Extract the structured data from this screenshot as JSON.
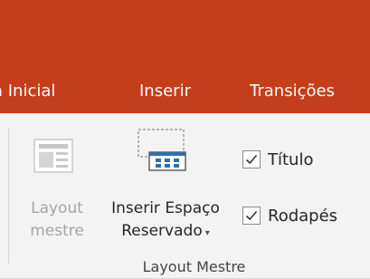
{
  "colors": {
    "accent": "#c43e1c",
    "ribbon_background": "#f3f3f3",
    "text": "#262626",
    "disabled_text": "#a6a6a6"
  },
  "tabs": [
    {
      "label": "a Inicial"
    },
    {
      "label": "Inserir"
    },
    {
      "label": "Transições"
    }
  ],
  "ribbon": {
    "layout_button": {
      "line1": "Layout",
      "line2": "mestre",
      "icon": "slide-layout-icon",
      "enabled": false
    },
    "insert_placeholder_button": {
      "line1": "Inserir Espaço",
      "line2": "Reservado",
      "icon": "insert-placeholder-icon",
      "has_dropdown": true
    },
    "checkboxes": [
      {
        "label": "Título",
        "checked": true
      },
      {
        "label": "Rodapés",
        "checked": true
      }
    ],
    "group_label": "Layout Mestre"
  }
}
